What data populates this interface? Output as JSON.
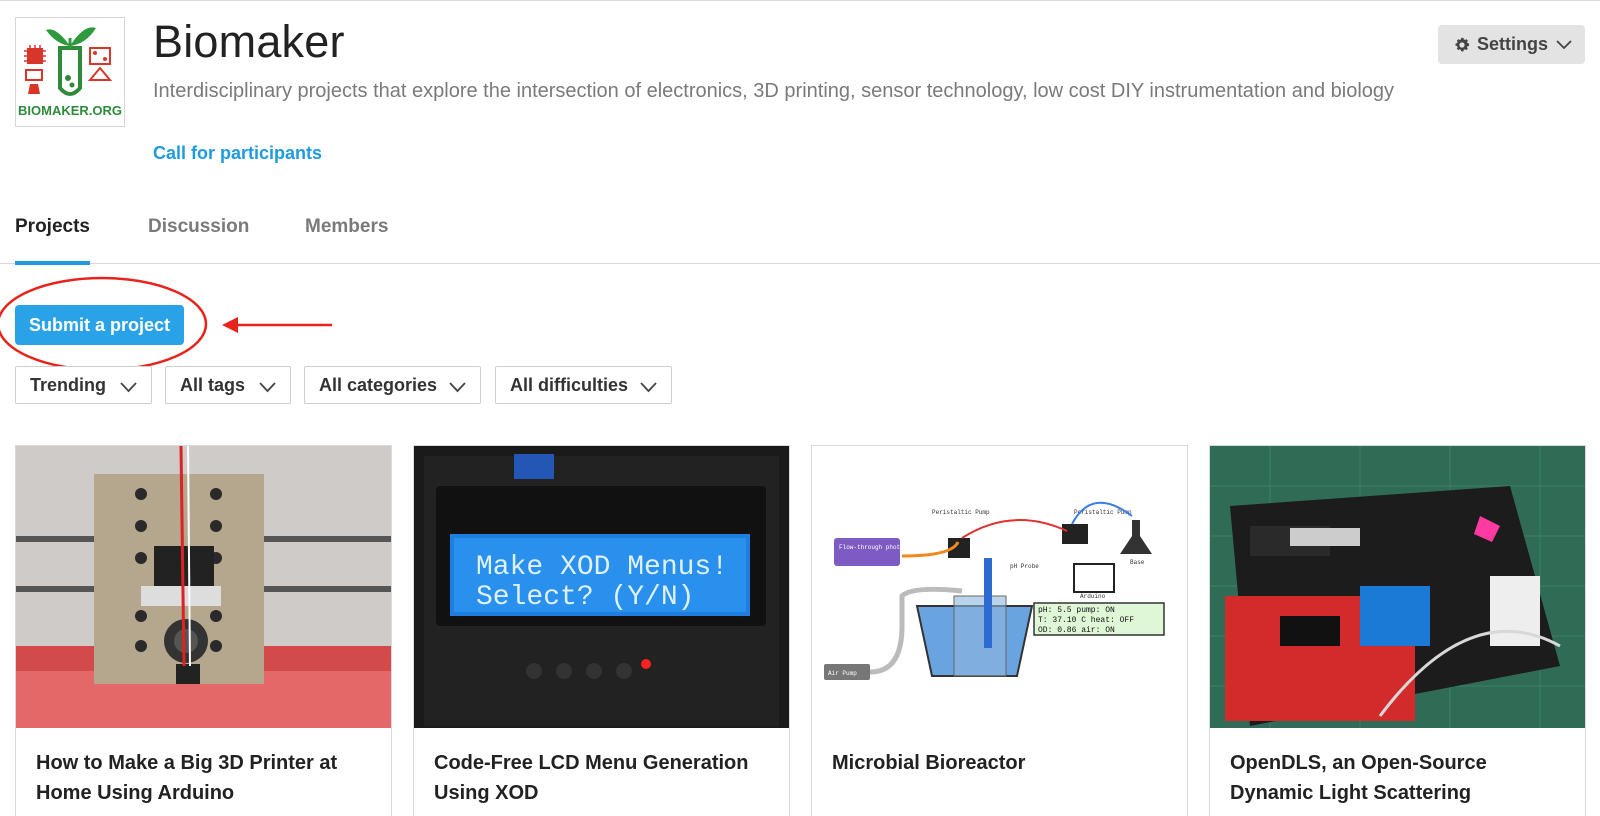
{
  "header": {
    "logo_text": "BIOMAKER.ORG",
    "title": "Biomaker",
    "description": "Interdisciplinary projects that explore the intersection of electronics, 3D printing, sensor technology, low cost DIY instrumentation and biology",
    "call_link": "Call for participants",
    "settings_label": "Settings"
  },
  "tabs": [
    {
      "label": "Projects",
      "active": true
    },
    {
      "label": "Discussion",
      "active": false
    },
    {
      "label": "Members",
      "active": false
    }
  ],
  "actions": {
    "submit_label": "Submit a project"
  },
  "filters": [
    {
      "label": "Trending"
    },
    {
      "label": "All tags"
    },
    {
      "label": "All categories"
    },
    {
      "label": "All difficulties"
    }
  ],
  "cards": [
    {
      "title": "How to Make a Big 3D Printer at Home Using Arduino"
    },
    {
      "title": "Code-Free LCD Menu Generation Using XOD",
      "lcd_line1": "Make XOD Menus!",
      "lcd_line2": "Select? (Y/N)"
    },
    {
      "title": "Microbial Bioreactor",
      "diagram_labels": {
        "pump1": "Peristaltic Pump",
        "pump2": "Peristaltic Pump",
        "photometer": "Flow-through photometer",
        "probe": "pH Probe",
        "arduino": "Arduino",
        "base": "Base",
        "air": "Air Pump",
        "readout1": "pH:     5.5 pump:  ON",
        "readout2": "T:  37.10 C heat: OFF",
        "readout3": "OD:    0.86 air:   ON"
      }
    },
    {
      "title": "OpenDLS, an Open-Source Dynamic Light Scattering"
    }
  ],
  "colors": {
    "accent": "#1e9be0",
    "button": "#2aa2e8",
    "annotation": "#e8231a"
  }
}
